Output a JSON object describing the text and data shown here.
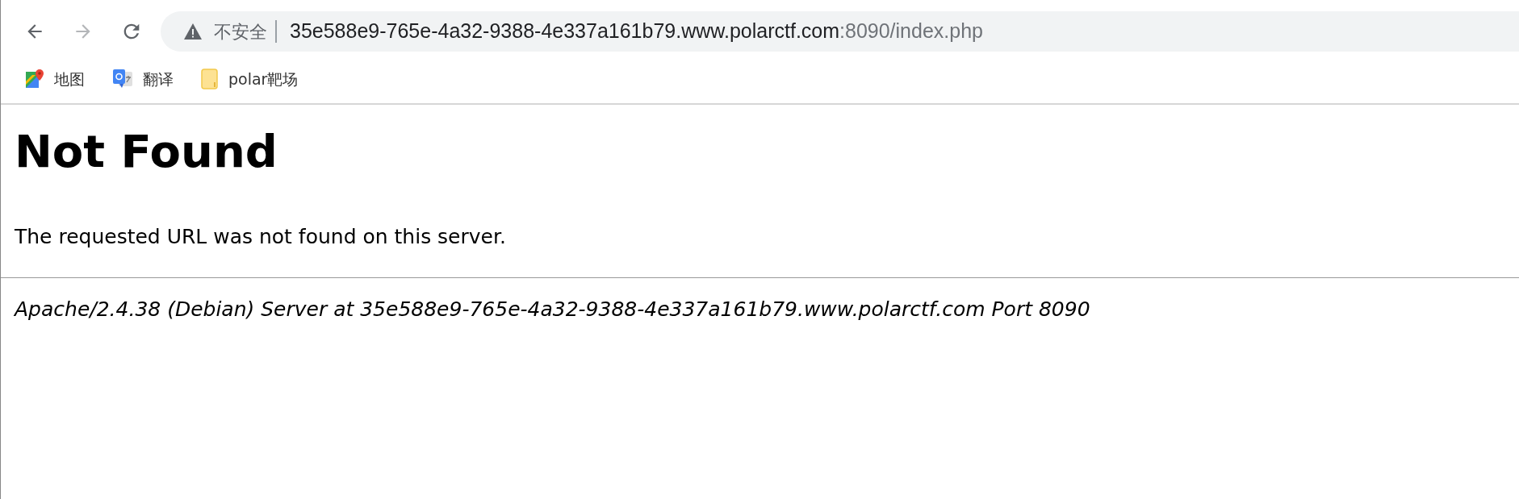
{
  "toolbar": {
    "back": {
      "disabled": false
    },
    "forward": {
      "disabled": true
    },
    "security_label": "不安全",
    "url_host": "35e588e9-765e-4a32-9388-4e337a161b79.www.polarctf.com",
    "url_rest": ":8090/index.php"
  },
  "bookmarks": [
    {
      "label": "地图",
      "kind": "maps"
    },
    {
      "label": "翻译",
      "kind": "translate"
    },
    {
      "label": "polar靶场",
      "kind": "folder"
    }
  ],
  "page": {
    "heading": "Not Found",
    "message": "The requested URL was not found on this server.",
    "address": "Apache/2.4.38 (Debian) Server at 35e588e9-765e-4a32-9388-4e337a161b79.www.polarctf.com Port 8090"
  }
}
